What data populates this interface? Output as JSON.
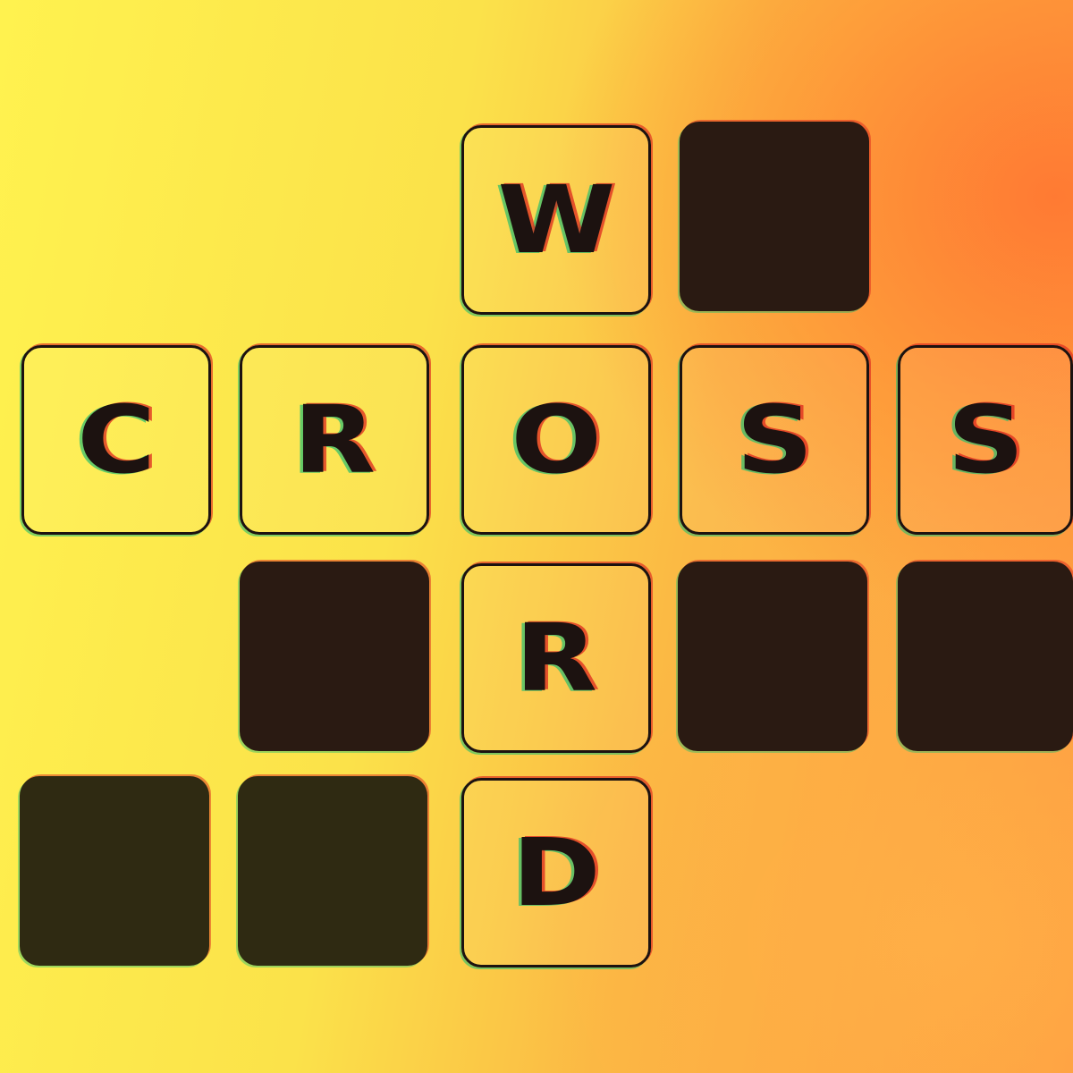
{
  "title_words": {
    "across": "CROSS",
    "down": "WORD"
  },
  "cells": {
    "w": "W",
    "c": "C",
    "r1": "R",
    "o": "O",
    "s1": "S",
    "s2": "S",
    "r2": "R",
    "d": "D"
  },
  "colors": {
    "background_left": "#fff24f",
    "background_right": "#ff9a42",
    "ink": "#1c1210",
    "block": "#2a1a12"
  }
}
